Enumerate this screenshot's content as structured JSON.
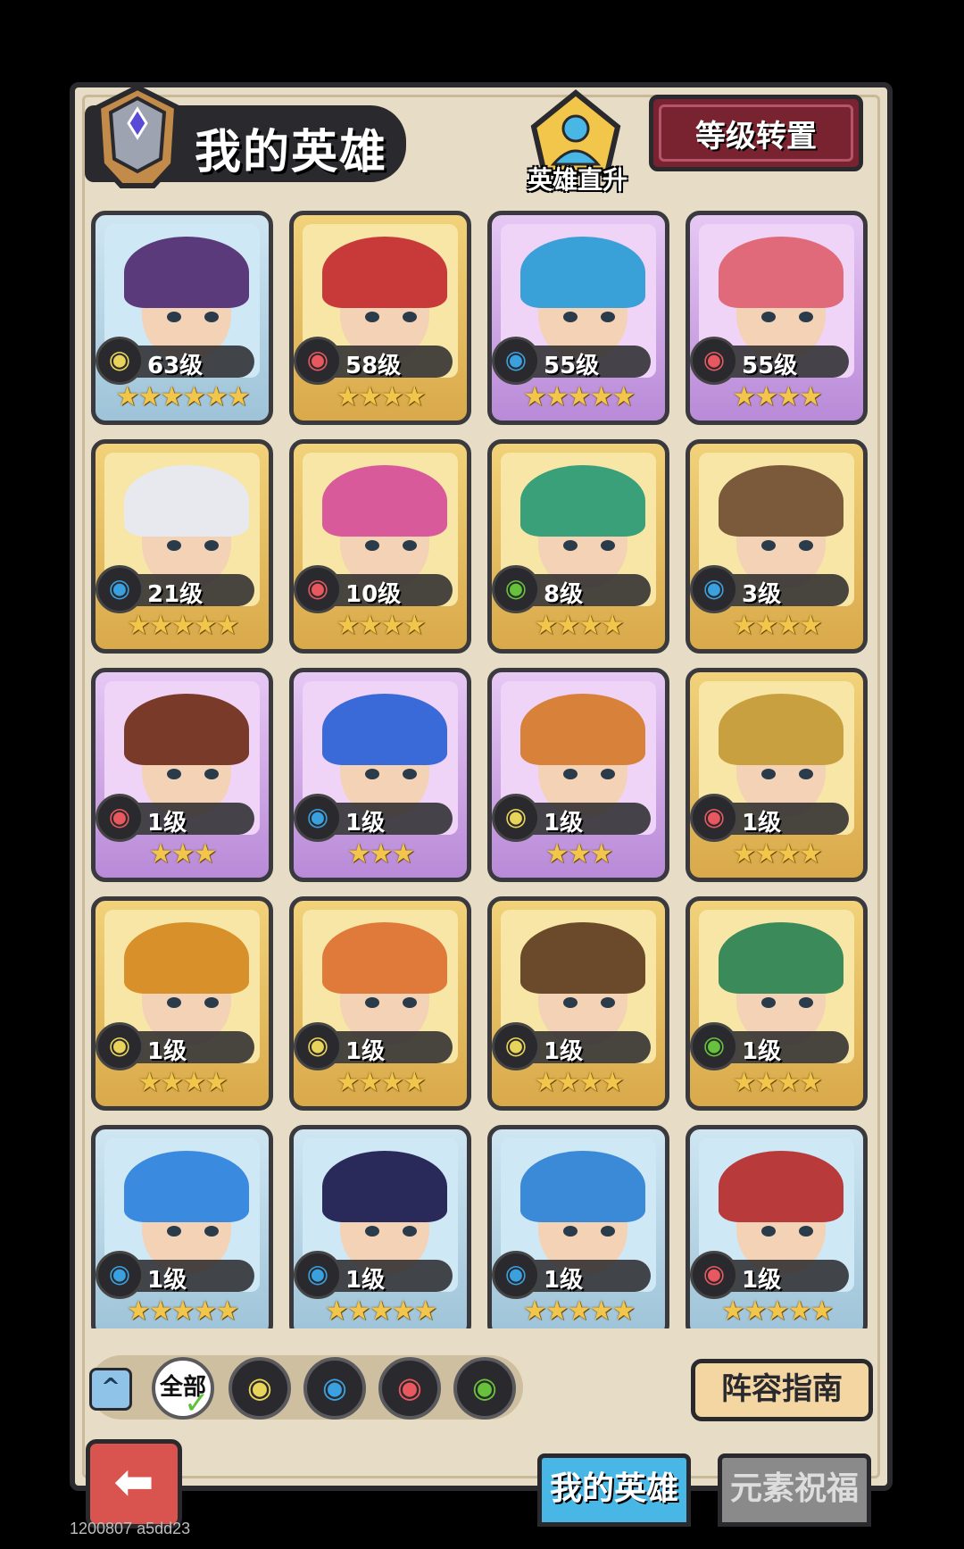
{
  "header": {
    "title": "我的英雄",
    "direct_upgrade_label": "英雄直升",
    "level_reset_label": "等级转置"
  },
  "heroes": [
    {
      "level": "63级",
      "stars": "★★★★★★",
      "element": "earth",
      "frame": "blue"
    },
    {
      "level": "58级",
      "stars": "★★★★",
      "element": "fire",
      "frame": "gold"
    },
    {
      "level": "55级",
      "stars": "★★★★★",
      "element": "water",
      "frame": "purple"
    },
    {
      "level": "55级",
      "stars": "★★★★",
      "element": "fire",
      "frame": "purple"
    },
    {
      "level": "21级",
      "stars": "★★★★★",
      "element": "water",
      "frame": "gold"
    },
    {
      "level": "10级",
      "stars": "★★★★",
      "element": "fire",
      "frame": "gold"
    },
    {
      "level": "8级",
      "stars": "★★★★",
      "element": "wind",
      "frame": "gold"
    },
    {
      "level": "3级",
      "stars": "★★★★",
      "element": "water",
      "frame": "gold"
    },
    {
      "level": "1级",
      "stars": "★★★",
      "element": "fire",
      "frame": "purple"
    },
    {
      "level": "1级",
      "stars": "★★★",
      "element": "water",
      "frame": "purple"
    },
    {
      "level": "1级",
      "stars": "★★★",
      "element": "earth",
      "frame": "purple"
    },
    {
      "level": "1级",
      "stars": "★★★★",
      "element": "fire",
      "frame": "gold"
    },
    {
      "level": "1级",
      "stars": "★★★★",
      "element": "earth",
      "frame": "gold"
    },
    {
      "level": "1级",
      "stars": "★★★★",
      "element": "earth",
      "frame": "gold"
    },
    {
      "level": "1级",
      "stars": "★★★★",
      "element": "earth",
      "frame": "gold"
    },
    {
      "level": "1级",
      "stars": "★★★★",
      "element": "wind",
      "frame": "gold"
    },
    {
      "level": "1级",
      "stars": "★★★★★",
      "element": "water",
      "frame": "blue"
    },
    {
      "level": "1级",
      "stars": "★★★★★",
      "element": "water",
      "frame": "blue"
    },
    {
      "level": "1级",
      "stars": "★★★★★",
      "element": "water",
      "frame": "blue"
    },
    {
      "level": "1级",
      "stars": "★★★★★",
      "element": "fire",
      "frame": "blue"
    }
  ],
  "filters": {
    "all_label": "全部",
    "elements": [
      "earth",
      "water",
      "fire",
      "wind"
    ]
  },
  "lineup_guide_label": "阵容指南",
  "tabs": {
    "my_heroes": "我的英雄",
    "element_blessing": "元素祝福"
  },
  "build_id": "1200807 a5dd23",
  "colors": {
    "fire": "#e8585e",
    "water": "#3aa0e0",
    "earth": "#e8d45a",
    "wind": "#66c23a"
  }
}
